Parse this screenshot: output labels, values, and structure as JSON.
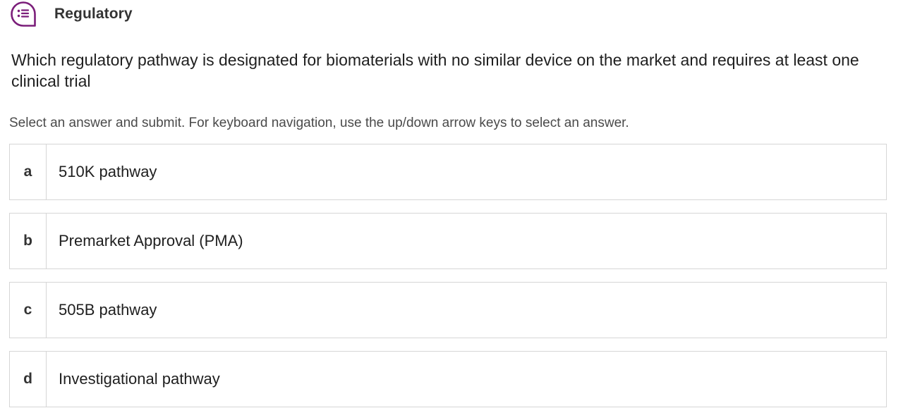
{
  "header": {
    "icon": "quiz-list-icon",
    "title": "Regulatory",
    "accent_color": "#7b1e7a"
  },
  "question": {
    "text": "Which regulatory pathway is designated for biomaterials with no similar device on the market and requires at least one clinical trial"
  },
  "instructions": "Select an answer and submit. For keyboard navigation, use the up/down arrow keys to select an answer.",
  "options": [
    {
      "letter": "a",
      "label": "510K pathway"
    },
    {
      "letter": "b",
      "label": "Premarket Approval (PMA)"
    },
    {
      "letter": "c",
      "label": "505B pathway"
    },
    {
      "letter": "d",
      "label": "Investigational pathway"
    }
  ]
}
